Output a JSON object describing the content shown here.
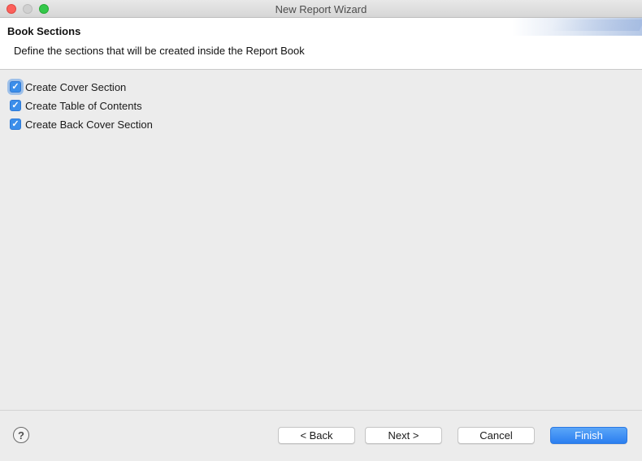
{
  "window": {
    "title": "New Report Wizard"
  },
  "header": {
    "title": "Book Sections",
    "description": "Define the sections that will be created inside the Report Book"
  },
  "options": [
    {
      "label": "Create Cover Section",
      "checked": true
    },
    {
      "label": "Create Table of Contents",
      "checked": true
    },
    {
      "label": "Create Back Cover Section",
      "checked": true
    }
  ],
  "footer": {
    "help_glyph": "?",
    "back_label": "< Back",
    "next_label": "Next >",
    "cancel_label": "Cancel",
    "finish_label": "Finish"
  },
  "colors": {
    "accent": "#3b8eea",
    "close": "#fc605b",
    "maximize": "#34c84a"
  }
}
